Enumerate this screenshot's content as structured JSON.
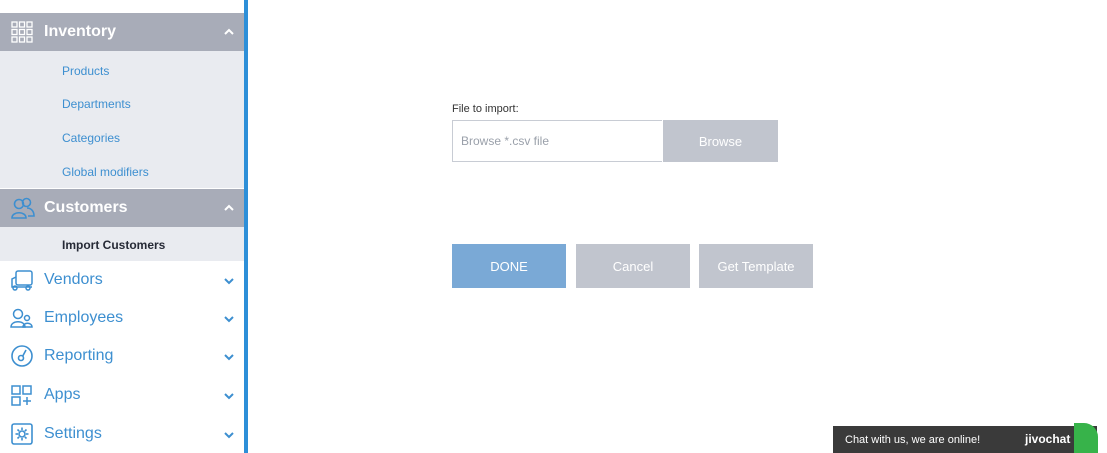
{
  "sidebar": {
    "inventory": {
      "label": "Inventory",
      "items": [
        "Products",
        "Departments",
        "Categories",
        "Global modifiers"
      ]
    },
    "customers": {
      "label": "Customers",
      "items": [
        "Import Customers"
      ]
    },
    "nav": [
      {
        "label": "Vendors",
        "icon": "truck-icon"
      },
      {
        "label": "Employees",
        "icon": "employees-icon"
      },
      {
        "label": "Reporting",
        "icon": "gauge-icon"
      },
      {
        "label": "Apps",
        "icon": "apps-icon"
      },
      {
        "label": "Settings",
        "icon": "gear-icon"
      }
    ]
  },
  "import": {
    "file_label": "File to import:",
    "placeholder": "Browse *.csv file",
    "browse_label": "Browse"
  },
  "actions": {
    "done": "DONE",
    "cancel": "Cancel",
    "template": "Get Template"
  },
  "chat": {
    "text": "Chat with us, we are online!",
    "brand": "jivochat"
  },
  "colors": {
    "accent": "#2d8fd8",
    "link": "#3d8fd0",
    "section_header": "#a8acb8",
    "submenu_bg": "#e9ebf0",
    "primary_button": "#7aa9d6",
    "muted_button": "#c1c5ce",
    "chat_bg": "#3a3a3a",
    "chat_badge": "#37b34a"
  }
}
